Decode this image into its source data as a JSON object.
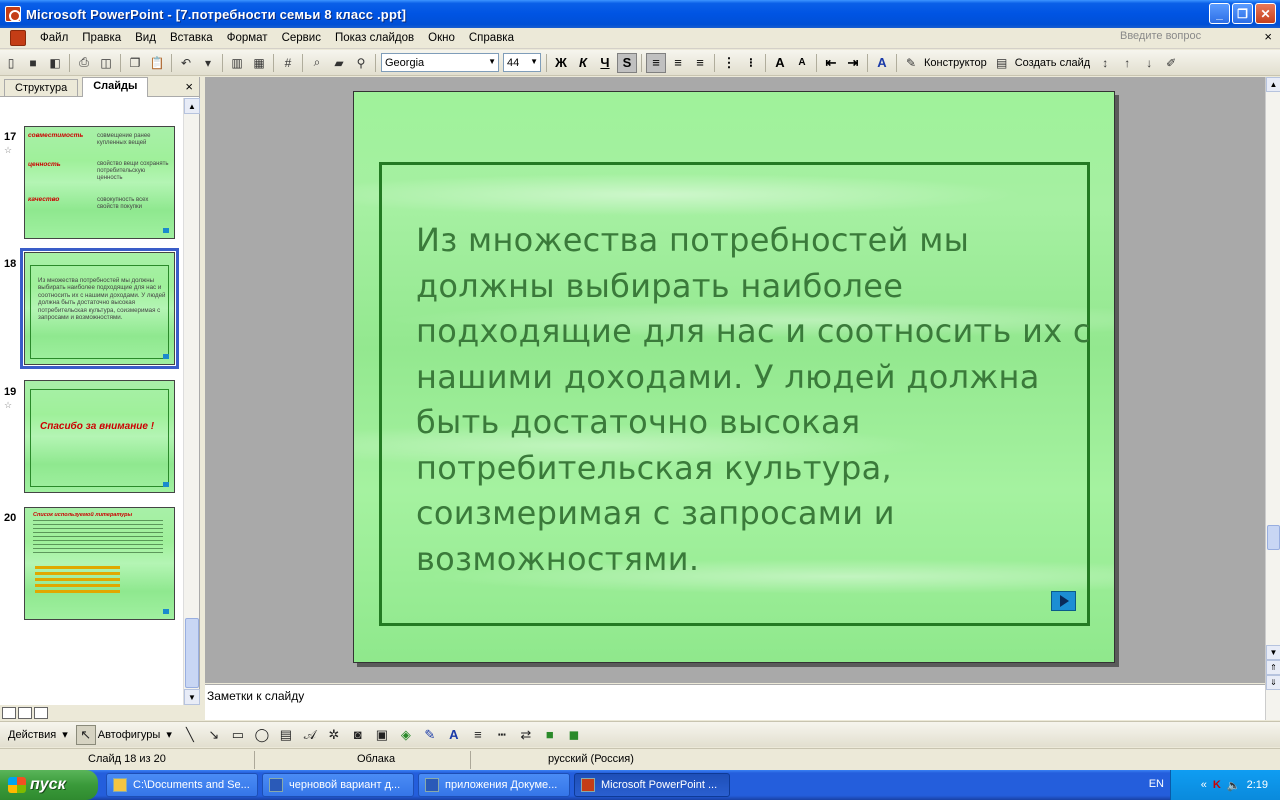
{
  "window": {
    "title": "Microsoft PowerPoint - [7.потребности семьи 8 класс .ppt]",
    "controls": [
      "_",
      "❐",
      "✕"
    ]
  },
  "menu": {
    "items": [
      "Файл",
      "Правка",
      "Вид",
      "Вставка",
      "Формат",
      "Сервис",
      "Показ слайдов",
      "Окно",
      "Справка"
    ],
    "help_placeholder": "Введите вопрос",
    "close": "×"
  },
  "toolbar": {
    "font_name": "Georgia",
    "font_size": "44",
    "bold": "Ж",
    "italic": "К",
    "underline": "Ч",
    "shadow": "S",
    "designer": "Конструктор",
    "new_slide": "Создать слайд"
  },
  "left_pane": {
    "tabs": [
      "Структура",
      "Слайды"
    ],
    "close": "×",
    "slides": [
      {
        "num": "17",
        "rows": [
          {
            "term": "совместимость",
            "def": "совмещение ранее купленных вещей"
          },
          {
            "term": "ценность",
            "def": "свойство вещи сохранять потребительскую ценность"
          },
          {
            "term": "качество",
            "def": "совокупность всех свойств покупки"
          }
        ]
      },
      {
        "num": "18",
        "text": "Из множества потребностей мы должны выбирать наиболее подходящие для нас и соотносить их с нашими доходами. У людей должна быть достаточно высокая потребительская культура, соизмеримая с запросами и возможностями."
      },
      {
        "num": "19",
        "title": "Спасибо за внимание !"
      },
      {
        "num": "20",
        "title": "Список используемой литературы"
      }
    ]
  },
  "slide": {
    "text": "Из множества потребностей мы должны выбирать наиболее подходящие для нас и соотносить их с нашими доходами. У людей должна быть достаточно высокая потребительская культура, соизмеримая с запросами и возможностями."
  },
  "notes": {
    "placeholder": "Заметки к слайду"
  },
  "drawbar": {
    "actions": "Действия",
    "autoshapes": "Автофигуры"
  },
  "status": {
    "slide": "Слайд 18 из 20",
    "design": "Облака",
    "language": "русский (Россия)"
  },
  "taskbar": {
    "start": "пуск",
    "tasks": [
      {
        "label": "C:\\Documents and Se...",
        "active": false
      },
      {
        "label": "черновой вариант д...",
        "active": false
      },
      {
        "label": "приложения Докуме...",
        "active": false
      },
      {
        "label": "Microsoft PowerPoint ...",
        "active": true
      }
    ],
    "lang": "EN",
    "clock": "2:19"
  }
}
